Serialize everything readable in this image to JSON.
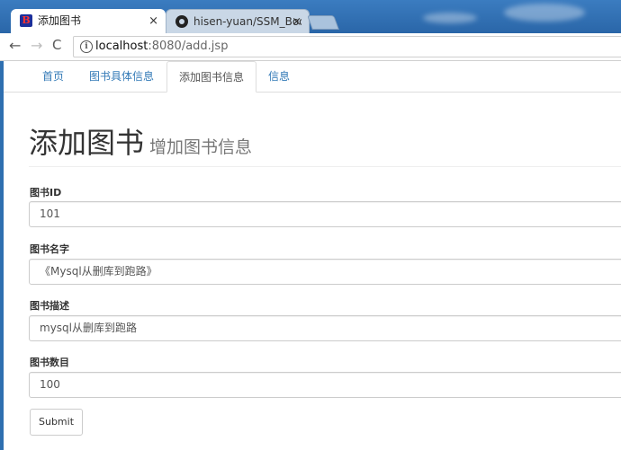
{
  "browser": {
    "tabs": [
      {
        "title": "添加图书",
        "close": "×",
        "favicon": "B"
      },
      {
        "title": "hisen-yuan/SSM_Book",
        "close": "×"
      }
    ],
    "nav": {
      "back": "←",
      "forward": "→",
      "reload": "C"
    },
    "url": {
      "host": "localhost",
      "rest": ":8080/add.jsp",
      "info": "i"
    }
  },
  "nav_tabs": [
    {
      "label": "首页"
    },
    {
      "label": "图书具体信息"
    },
    {
      "label": "添加图书信息"
    },
    {
      "label": "信息"
    }
  ],
  "header": {
    "title": "添加图书",
    "subtitle": "增加图书信息"
  },
  "form": {
    "fields": [
      {
        "label": "图书ID",
        "value": "101"
      },
      {
        "label": "图书名字",
        "value": "《Mysql从删库到跑路》"
      },
      {
        "label": "图书描述",
        "value": "mysql从删库到跑路"
      },
      {
        "label": "图书数目",
        "value": "100"
      }
    ],
    "submit_label": "Submit"
  },
  "colors": {
    "link": "#337ab7",
    "window": "#2f6fb0"
  }
}
